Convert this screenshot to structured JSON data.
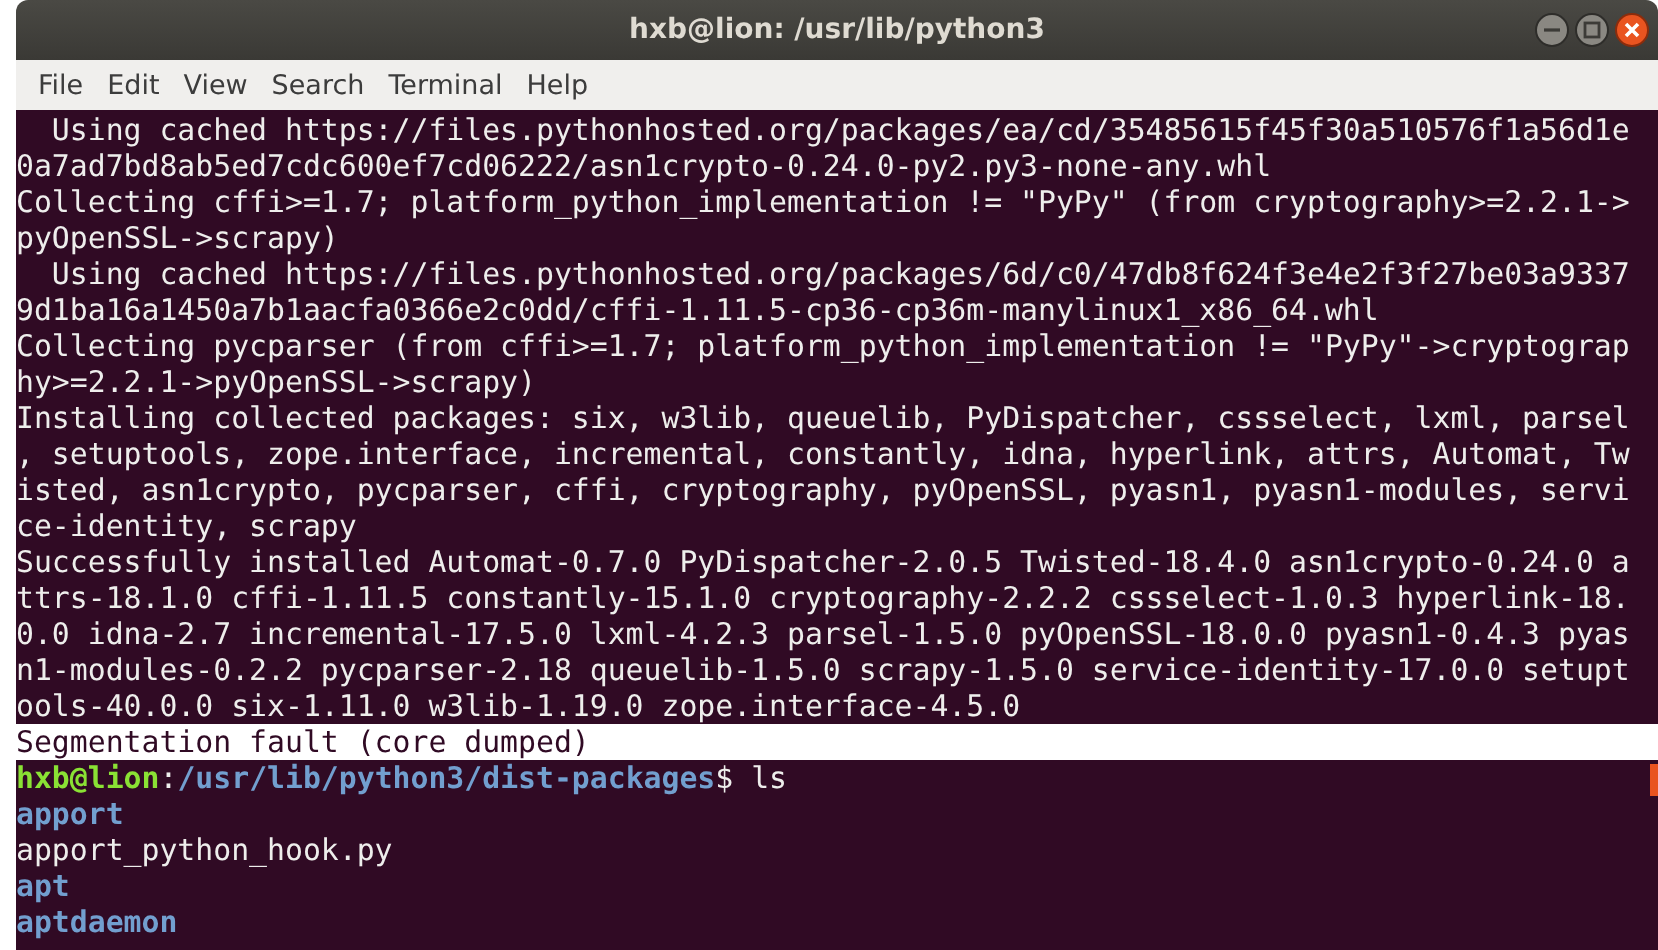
{
  "window": {
    "title": "hxb@lion: /usr/lib/python3"
  },
  "menu": [
    "File",
    "Edit",
    "View",
    "Search",
    "Terminal",
    "Help"
  ],
  "terminal": {
    "lines": [
      {
        "kind": "output",
        "text": "  Using cached https://files.pythonhosted.org/packages/ea/cd/35485615f45f30a510576f1a56d1e"
      },
      {
        "kind": "output",
        "text": "0a7ad7bd8ab5ed7cdc600ef7cd06222/asn1crypto-0.24.0-py2.py3-none-any.whl"
      },
      {
        "kind": "output",
        "text": "Collecting cffi>=1.7; platform_python_implementation != \"PyPy\" (from cryptography>=2.2.1->"
      },
      {
        "kind": "output",
        "text": "pyOpenSSL->scrapy)"
      },
      {
        "kind": "output",
        "text": "  Using cached https://files.pythonhosted.org/packages/6d/c0/47db8f624f3e4e2f3f27be03a9337"
      },
      {
        "kind": "output",
        "text": "9d1ba16a1450a7b1aacfa0366e2c0dd/cffi-1.11.5-cp36-cp36m-manylinux1_x86_64.whl"
      },
      {
        "kind": "output",
        "text": "Collecting pycparser (from cffi>=1.7; platform_python_implementation != \"PyPy\"->cryptograp"
      },
      {
        "kind": "output",
        "text": "hy>=2.2.1->pyOpenSSL->scrapy)"
      },
      {
        "kind": "output",
        "text": "Installing collected packages: six, w3lib, queuelib, PyDispatcher, cssselect, lxml, parsel"
      },
      {
        "kind": "output",
        "text": ", setuptools, zope.interface, incremental, constantly, idna, hyperlink, attrs, Automat, Tw"
      },
      {
        "kind": "output",
        "text": "isted, asn1crypto, pycparser, cffi, cryptography, pyOpenSSL, pyasn1, pyasn1-modules, servi"
      },
      {
        "kind": "output",
        "text": "ce-identity, scrapy"
      },
      {
        "kind": "output",
        "text": "Successfully installed Automat-0.7.0 PyDispatcher-2.0.5 Twisted-18.4.0 asn1crypto-0.24.0 a"
      },
      {
        "kind": "output",
        "text": "ttrs-18.1.0 cffi-1.11.5 constantly-15.1.0 cryptography-2.2.2 cssselect-1.0.3 hyperlink-18."
      },
      {
        "kind": "output",
        "text": "0.0 idna-2.7 incremental-17.5.0 lxml-4.2.3 parsel-1.5.0 pyOpenSSL-18.0.0 pyasn1-0.4.3 pyas"
      },
      {
        "kind": "output",
        "text": "n1-modules-0.2.2 pycparser-2.18 queuelib-1.5.0 scrapy-1.5.0 service-identity-17.0.0 setupt"
      },
      {
        "kind": "output",
        "text": "ools-40.0.0 six-1.11.0 w3lib-1.19.0 zope.interface-4.5.0"
      },
      {
        "kind": "highlight",
        "text": "Segmentation fault (core dumped)"
      },
      {
        "kind": "prompt",
        "user": "hxb@lion",
        "separator": ":",
        "path": "/usr/lib/python3/dist-packages",
        "command": "$ ls"
      },
      {
        "kind": "directory",
        "text": "apport"
      },
      {
        "kind": "output",
        "text": "apport_python_hook.py"
      },
      {
        "kind": "directory",
        "text": "apt"
      },
      {
        "kind": "directory",
        "text": "aptdaemon"
      }
    ]
  }
}
